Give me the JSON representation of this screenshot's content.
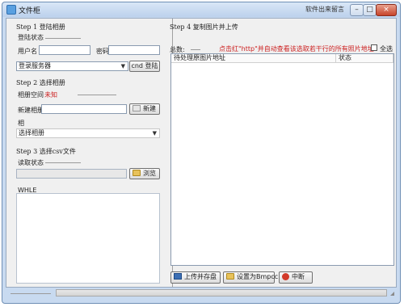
{
  "window": {
    "title": "文件柜",
    "watermark": "软件出来留言",
    "controls": {
      "minimize": "–",
      "maximize": "□",
      "close": "×"
    }
  },
  "left": {
    "step1": {
      "header": "Step 1 登陆相册",
      "status_label": "登陆状态",
      "username_label": "用户名",
      "username_value": "",
      "password_label": "密码",
      "password_value": "",
      "server_select": "登录服务器",
      "login_button": "cnd 登陆"
    },
    "step2": {
      "header": "Step 2 选择相册",
      "space_label": "相册空间",
      "space_value": "未知",
      "new_album_label": "新建相册",
      "new_album_value": "",
      "create_button": "新建",
      "album_label": "相",
      "album_select": "选择相册"
    },
    "step3": {
      "header": "Step 3 选择csv文件",
      "read_status_label": "读取状态",
      "file_path_value": "",
      "browse_button": "浏览"
    },
    "log_label": "WHLE"
  },
  "right": {
    "step4": {
      "header": "Step 4 复制图片并上传",
      "total_label": "总数:",
      "total_value": "",
      "hint_text": "点击红\"http\"并自动查看该选取若干行的所有照片地址",
      "select_all_label": "全选",
      "columns": [
        "待处理原图片地址",
        "状态"
      ]
    },
    "buttons": {
      "upload": "上传并存盘",
      "export": "设置为Bmpcc",
      "stop": "中断"
    }
  }
}
